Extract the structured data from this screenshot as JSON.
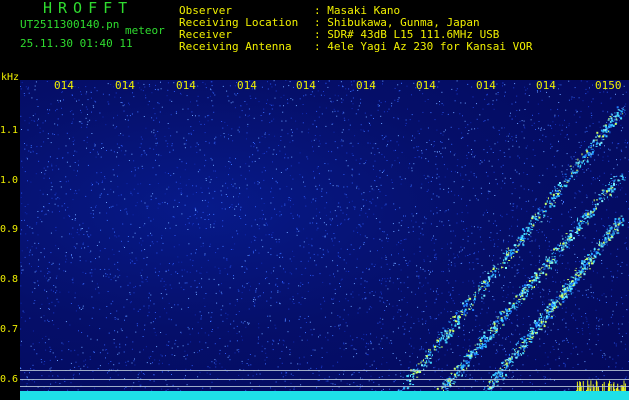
{
  "header": {
    "app_name": "HROFFT",
    "filename": "UT2511300140.pn",
    "mode": "meteor",
    "timestamp": "25.11.30 01:40   11",
    "fields": [
      {
        "label": "Observer",
        "value": ": Masaki Kano"
      },
      {
        "label": "Receiving Location",
        "value": ": Shibukawa, Gunma, Japan"
      },
      {
        "label": "Receiver",
        "value": ": SDR# 43dB L15 111.6MHz USB"
      },
      {
        "label": "Receiving Antenna",
        "value": ": 4ele Yagi Az 230 for Kansai VOR"
      }
    ]
  },
  "axis": {
    "unit": "kHz",
    "time_ticks": [
      "014",
      "014",
      "014",
      "014",
      "014",
      "014",
      "014",
      "014",
      "014",
      "0150"
    ],
    "freq_ticks": [
      "1.1",
      "1.0",
      "0.9",
      "0.8",
      "0.7",
      "0.6"
    ]
  },
  "colors": {
    "header_green": "#2fdc2f",
    "label_yellow": "#f0f000",
    "background_blue": "#050f6a",
    "signal_cyan": "#1ee0e8"
  }
}
